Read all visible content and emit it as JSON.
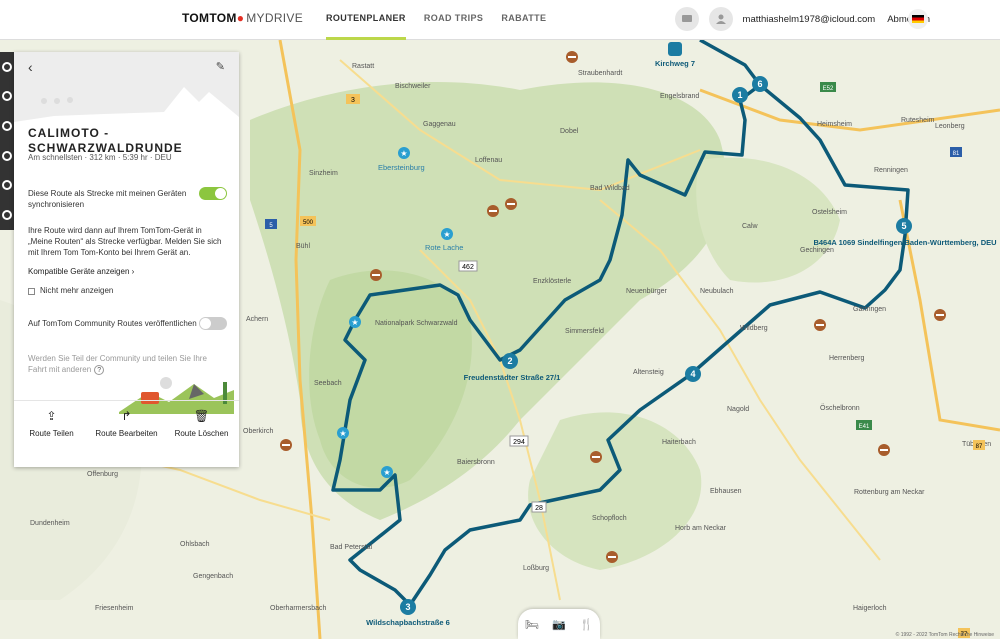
{
  "header": {
    "logo_brand": "TOMTOM",
    "logo_product": "MYDRIVE",
    "nav": [
      "ROUTENPLANER",
      "ROAD TRIPS",
      "RABATTE"
    ],
    "email": "matthiashelm1978@icloud.com",
    "logout": "Abmelden"
  },
  "panel": {
    "title": "CALIMOTO - SCHWARZWALDRUNDE",
    "meta": "Am schnellsten · 312 km · 5:39 hr · DEU",
    "sync_label": "Diese Route als Strecke mit meinen Geräten synchronisieren",
    "sync_info": "Ihre Route wird dann auf Ihrem TomTom-Gerät in „Meine Routen“ als Strecke verfügbar. Melden Sie sich mit Ihrem Tom Tom-Konto bei Ihrem Gerät an.",
    "compat_link": "Kompatible Geräte anzeigen",
    "dont_show": "Nicht mehr anzeigen",
    "community_label": "Auf TomTom Community Routes veröffentlichen",
    "community_info": "Werden Sie Teil der Community und teilen Sie Ihre Fahrt mit anderen",
    "actions": {
      "share": "Route Teilen",
      "edit": "Route Bearbeiten",
      "delete": "Route Löschen"
    }
  },
  "map": {
    "towns": [
      "Rastatt",
      "Bischweiler",
      "Straubenhardt",
      "Engelsbrand",
      "Gaggenau",
      "Dobel",
      "Heimsheim",
      "Rutesheim",
      "Leonberg",
      "Ebersteinburg",
      "Loffenau",
      "Sinzheim",
      "Bad Wildbad",
      "Renningen",
      "Ostelsheim",
      "Calw",
      "Gechingen",
      "Bühl",
      "Rote Lache",
      "Enzklösterle",
      "Neuenbürger",
      "Neubulach",
      "Gärtringen",
      "Achern",
      "Nationalpark Schwarzwald",
      "Simmersfeld",
      "Wildberg",
      "Herrenberg",
      "Altensteig",
      "Seebach",
      "Nagold",
      "Öschelbronn",
      "Oberkirch",
      "Haiterbach",
      "Tübingen",
      "Baiersbronn",
      "Offenburg",
      "Ebhausen",
      "Rottenburg am Neckar",
      "Dundenheim",
      "Schopfloch",
      "Horb am Neckar",
      "Ohlsbach",
      "Bad Peterstal",
      "Gengenbach",
      "Loßburg",
      "Friesenheim",
      "Oberharmersbach",
      "Haigerloch"
    ],
    "waypoints": [
      {
        "n": "1",
        "label": "Kirchweg 7"
      },
      {
        "n": "2",
        "label": "Freudenstädter Straße 27/1"
      },
      {
        "n": "3",
        "label": "Wildschapbachstraße 6"
      },
      {
        "n": "4",
        "label": ""
      },
      {
        "n": "5",
        "label": "B464A 1069 Sindelfingen Baden-Württemberg, DEU"
      },
      {
        "n": "6",
        "label": ""
      }
    ],
    "roads": [
      "3",
      "462",
      "294",
      "28",
      "E52",
      "81",
      "E41",
      "5",
      "500",
      "87",
      "77"
    ],
    "copyright": "© 1992 - 2022 TomTom    Rechtliche Hinweise"
  },
  "colors": {
    "route": "#0c5a78",
    "accent": "#8cc63f",
    "toggle_off": "#cccccc"
  }
}
